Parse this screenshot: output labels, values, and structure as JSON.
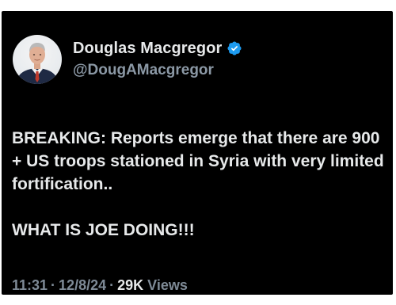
{
  "author": {
    "display_name": "Douglas Macgregor",
    "handle": "@DougAMacgregor",
    "verified": true,
    "verified_color": "#1d9bf0"
  },
  "tweet": {
    "paragraphs": [
      "BREAKING: Reports emerge that there are 900 + US troops stationed in Syria with very limited fortification..",
      "WHAT IS JOE DOING!!!"
    ]
  },
  "meta": {
    "time": "11:31",
    "separator": "·",
    "date": "12/8/24",
    "views_count": "29K",
    "views_label": "Views"
  },
  "colors": {
    "background": "#000000",
    "text_primary": "#e7e9ea",
    "text_secondary": "#8b98a5"
  }
}
